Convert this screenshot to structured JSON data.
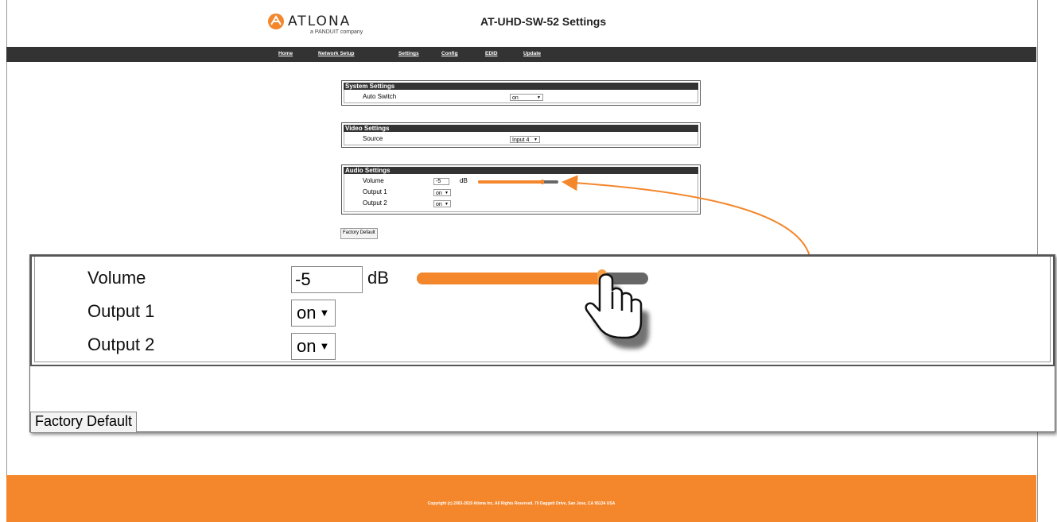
{
  "brand": {
    "logo_text": "ATLONA",
    "logo_sub": "a PANDUIT company",
    "accent_color": "#f4862b"
  },
  "page_title": "AT-UHD-SW-52 Settings",
  "nav": [
    {
      "label": "Home"
    },
    {
      "label": "Network Setup"
    },
    {
      "label": "Settings"
    },
    {
      "label": "Config"
    },
    {
      "label": "EDID"
    },
    {
      "label": "Update"
    }
  ],
  "system_settings": {
    "legend": "System Settings",
    "auto_switch_label": "Auto Switch",
    "auto_switch_value": "on"
  },
  "video_settings": {
    "legend": "Video Settings",
    "source_label": "Source",
    "source_value": "Input 4"
  },
  "audio_settings": {
    "legend": "Audio Settings",
    "volume_label": "Volume",
    "volume_value": "-5",
    "volume_unit": "dB",
    "volume_slider_fraction": 0.79,
    "output1_label": "Output 1",
    "output1_value": "on",
    "output2_label": "Output 2",
    "output2_value": "on"
  },
  "factory_default_label": "Factory Default",
  "footer": {
    "copyright": "Copyright (c) 2003-2019 Atlona Inc. All Rights Reserved. 70 Daggett Drive, San Jose, CA 95134 USA"
  },
  "icons": {
    "pointer": "hand-pointer-icon",
    "arrow": "callout-arrow-icon",
    "dropdown": "triangle-down-icon"
  }
}
